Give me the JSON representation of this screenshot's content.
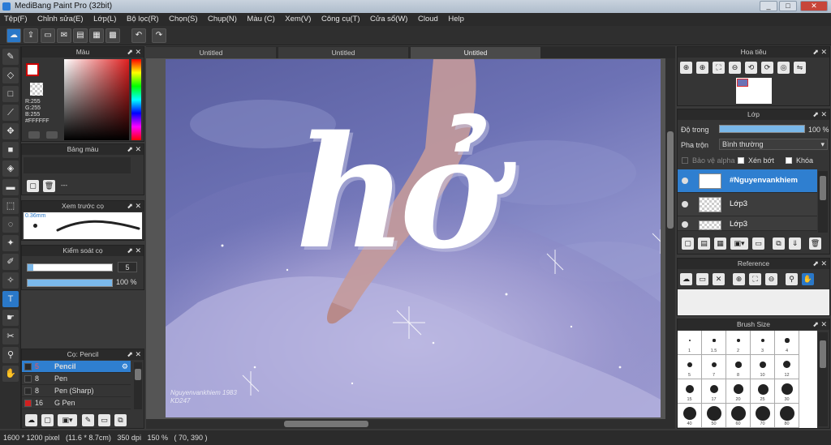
{
  "window": {
    "title": "MediBang Paint Pro (32bit)"
  },
  "menu": [
    "Tệp(F)",
    "Chỉnh sửa(E)",
    "Lớp(L)",
    "Bộ lọc(R)",
    "Chọn(S)",
    "Chụp(N)",
    "Màu (C)",
    "Xem(V)",
    "Công cụ(T)",
    "Cửa sổ(W)",
    "Cloud",
    "Help"
  ],
  "tabs": [
    "Untitled",
    "Untitled",
    "Untitled"
  ],
  "color_panel": {
    "title": "Màu",
    "r": "R:255",
    "g": "G:255",
    "b": "B:255",
    "hex": "#FFFFFF"
  },
  "palette_panel": {
    "title": "Bảng màu",
    "value": "---"
  },
  "brush_preview": {
    "title": "Xem trước cọ",
    "size": "0.36mm"
  },
  "brush_control": {
    "title": "Kiểm soát cọ",
    "size": "5",
    "opacity": "100 %"
  },
  "brush_list": {
    "title": "Cọ: Pencil",
    "items": [
      {
        "size": "5",
        "name": "Pencil",
        "swatch": "#222222"
      },
      {
        "size": "8",
        "name": "Pen",
        "swatch": "#222222"
      },
      {
        "size": "8",
        "name": "Pen (Sharp)",
        "swatch": "#222222"
      },
      {
        "size": "16",
        "name": "G Pen",
        "swatch": "#d02020"
      }
    ]
  },
  "navigator": {
    "title": "Hoa tiêu"
  },
  "layers": {
    "title": "Lớp",
    "opacity_label": "Độ trong",
    "opacity_value": "100 %",
    "blend_label": "Pha trộn",
    "blend_value": "Bình thường",
    "protect_alpha": "Bảo vệ alpha",
    "clipping": "Xén bớt",
    "lock": "Khóa",
    "items": [
      "#Nguyenvankhiem",
      "Lớp3",
      "Lớp3"
    ]
  },
  "reference": {
    "title": "Reference"
  },
  "brush_size": {
    "title": "Brush Size",
    "sizes": [
      "1",
      "1.5",
      "2",
      "3",
      "4",
      "5",
      "7",
      "8",
      "10",
      "12",
      "15",
      "17",
      "20",
      "25",
      "30",
      "40",
      "50",
      "60",
      "70",
      "80",
      "100",
      "120",
      "150",
      "200",
      "250"
    ]
  },
  "artwork": {
    "text": "hở",
    "signature": "Nguyenvankhiem 1983\nKD247"
  },
  "status": "1600 * 1200 pixel   (11.6 * 8.7cm)   350 dpi   150 %   ( 70, 390 )",
  "colors": {
    "accent": "#2f7fd0",
    "panel": "#353535"
  }
}
